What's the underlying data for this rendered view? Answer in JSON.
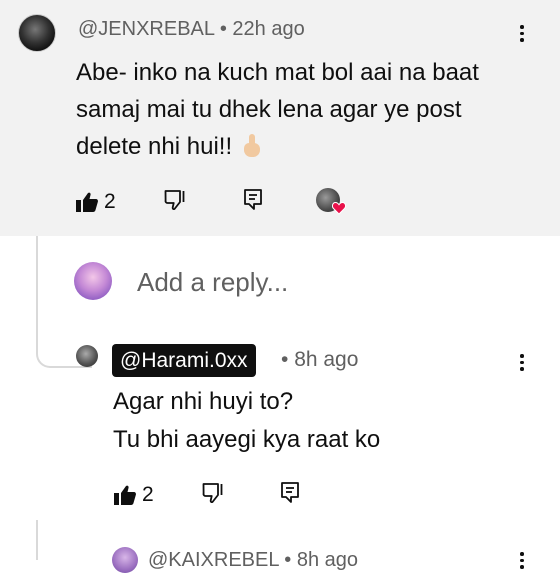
{
  "comment": {
    "handle": "@JENXREBAL",
    "time": "22h ago",
    "text": "Abe- inko na kuch mat bol aai na baat samaj mai tu dhek lena agar ye post delete nhi hui!!",
    "emoji": "point-up-hand-emoji",
    "like_count": "2"
  },
  "reply_box": {
    "placeholder": "Add a reply..."
  },
  "reply": {
    "handle": "@Harami.0xx",
    "time": "8h ago",
    "lines": [
      "Agar nhi huyi to?",
      "Tu bhi aayegi kya raat ko"
    ],
    "like_count": "2"
  },
  "next_reply": {
    "handle_partial": "@KAIXREBEL • 8h ago"
  },
  "colors": {
    "top_background": "#f2f2f2",
    "secondary_text": "#606060",
    "heart": "#e8114a",
    "badge_bg": "#0f0f0f"
  }
}
